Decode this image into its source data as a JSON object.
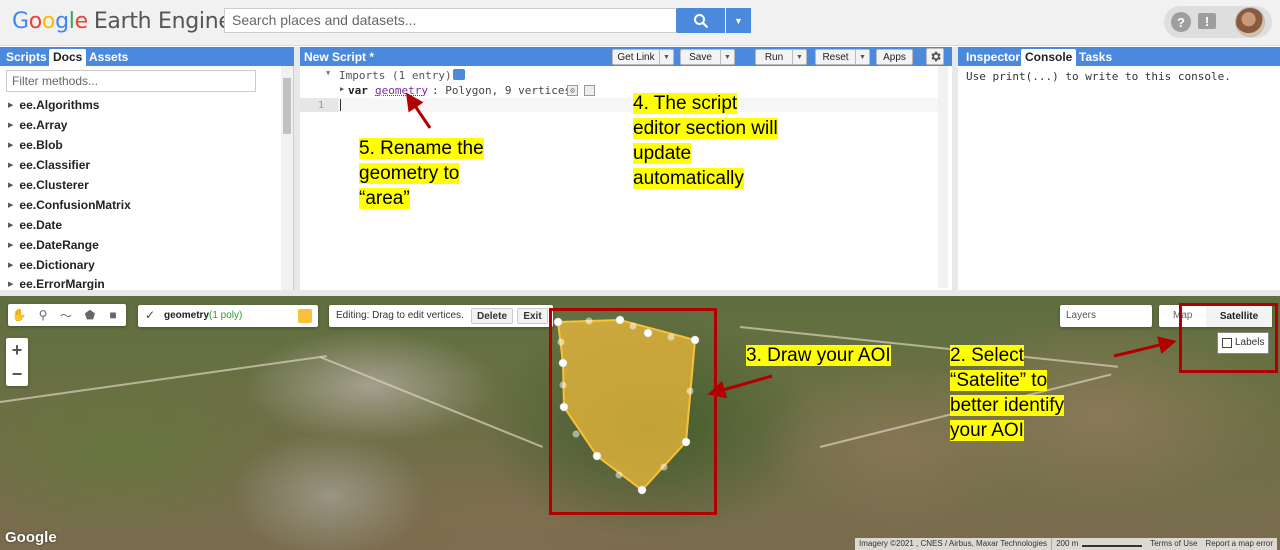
{
  "header": {
    "logo": {
      "g": "G",
      "o1": "o",
      "o2": "o",
      "g2": "g",
      "l": "l",
      "e": "e",
      "product": "Earth Engine"
    },
    "search_placeholder": "Search places and datasets...",
    "help_glyph": "?",
    "feedback_glyph": "!"
  },
  "left_panel": {
    "tabs": [
      "Scripts",
      "Docs",
      "Assets"
    ],
    "filter_placeholder": "Filter methods...",
    "items": [
      "ee.Algorithms",
      "ee.Array",
      "ee.Blob",
      "ee.Classifier",
      "ee.Clusterer",
      "ee.ConfusionMatrix",
      "ee.Date",
      "ee.DateRange",
      "ee.Dictionary",
      "ee.ErrorMargin"
    ]
  },
  "editor": {
    "title": "New Script *",
    "buttons": {
      "get_link": "Get Link",
      "save": "Save",
      "run": "Run",
      "reset": "Reset",
      "apps": "Apps"
    },
    "imports_line": "Imports (1 entry)",
    "var_kw": "var",
    "var_name": "geometry",
    "var_desc": ": Polygon, 9 vertices",
    "line_number": "1"
  },
  "right_panel": {
    "tabs": [
      "Inspector",
      "Console",
      "Tasks"
    ],
    "console_text": "Use print(...) to write to this console."
  },
  "map": {
    "geometry_layer": {
      "name": "geometry",
      "count": "(1 poly)",
      "color": "#f9c13a"
    },
    "editing": {
      "text": "Editing: Drag to edit vertices.",
      "delete": "Delete",
      "exit": "Exit"
    },
    "layers_label": "Layers",
    "map_type": {
      "map": "Map",
      "satellite": "Satellite"
    },
    "labels_option": "Labels",
    "zoom": {
      "in": "+",
      "out": "−"
    },
    "watermark": "Google",
    "attribution": [
      "Imagery ©2021 , CNES / Airbus, Maxar Technologies",
      "200 m",
      "Terms of Use",
      "Report a map error"
    ]
  },
  "annotations": {
    "step2": [
      "2. Select",
      "“Satelite” to",
      "better identify",
      "your AOI"
    ],
    "step3": [
      "3. Draw your AOI"
    ],
    "step4": [
      "4. The script",
      "editor section will",
      "update",
      "automatically"
    ],
    "step5": [
      "5. Rename the",
      "geometry to",
      "“area”"
    ]
  },
  "colors": {
    "accent": "#4a89dc",
    "annotation_highlight": "#ffff00",
    "annotation_box": "#b00000",
    "polygon_fill": "#f9c13a"
  }
}
